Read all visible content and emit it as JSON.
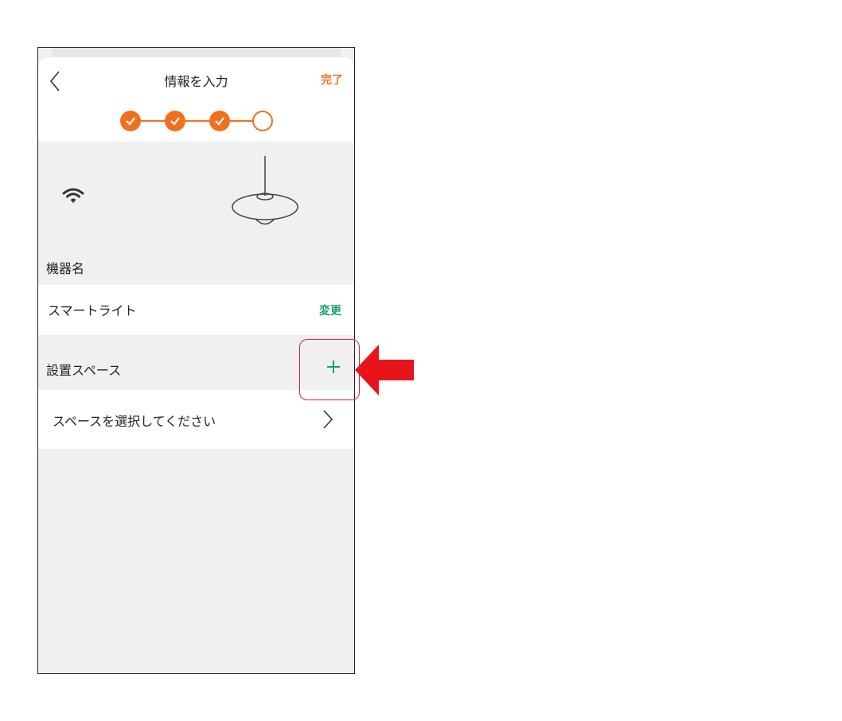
{
  "header": {
    "title": "情報を入力",
    "done_label": "完了"
  },
  "progress": {
    "completed_steps": 3,
    "total_steps": 4
  },
  "device": {
    "name_section_label": "機器名",
    "name_value": "スマートライト",
    "change_label": "変更",
    "connection_icon": "wifi-icon",
    "device_icon": "pendant-lamp-icon"
  },
  "space": {
    "section_label": "設置スペース",
    "add_icon": "plus-icon",
    "select_placeholder": "スペースを選択してください"
  },
  "colors": {
    "accent_orange": "#f07020",
    "accent_green": "#1aa06a",
    "annotation_red": "#e0202a",
    "background_gray": "#f0f0f0"
  }
}
